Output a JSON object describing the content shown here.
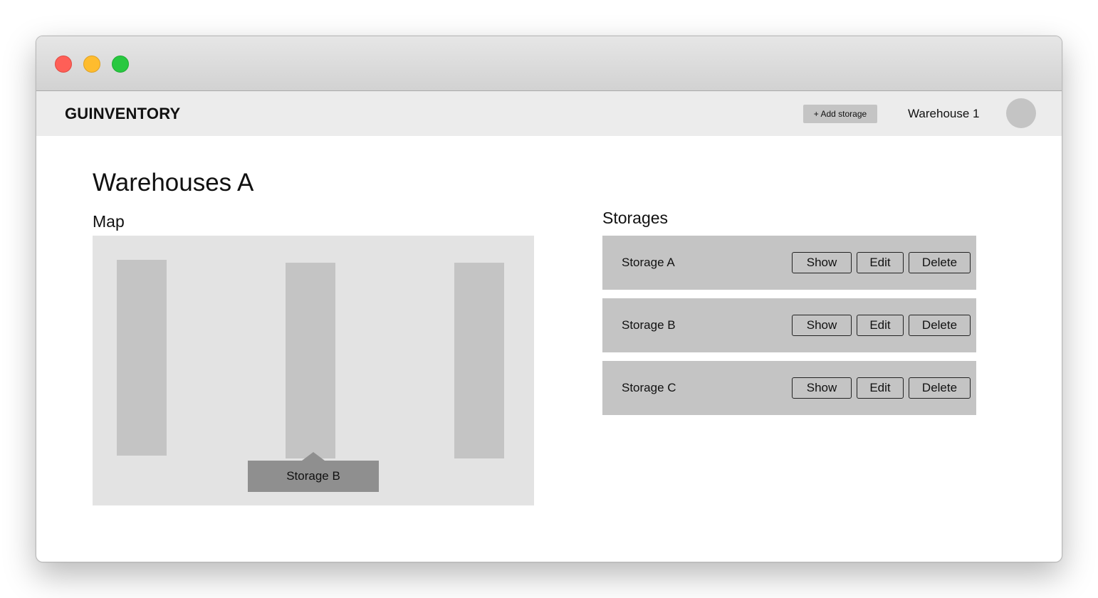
{
  "app": {
    "brand": "GUINVENTORY",
    "add_storage_label": "+ Add storage",
    "warehouse_selector": "Warehouse 1"
  },
  "page": {
    "title": "Warehouses A",
    "map_label": "Map",
    "storages_label": "Storages"
  },
  "map": {
    "tooltip": "Storage B"
  },
  "storages": [
    {
      "name": "Storage A",
      "show": "Show",
      "edit": "Edit",
      "delete": "Delete"
    },
    {
      "name": "Storage B",
      "show": "Show",
      "edit": "Edit",
      "delete": "Delete"
    },
    {
      "name": "Storage C",
      "show": "Show",
      "edit": "Edit",
      "delete": "Delete"
    }
  ],
  "colors": {
    "appbar_bg": "#ececec",
    "block_gray": "#c4c4c4",
    "map_bg": "#e3e3e3",
    "tooltip_bg": "#8f8f8f"
  }
}
